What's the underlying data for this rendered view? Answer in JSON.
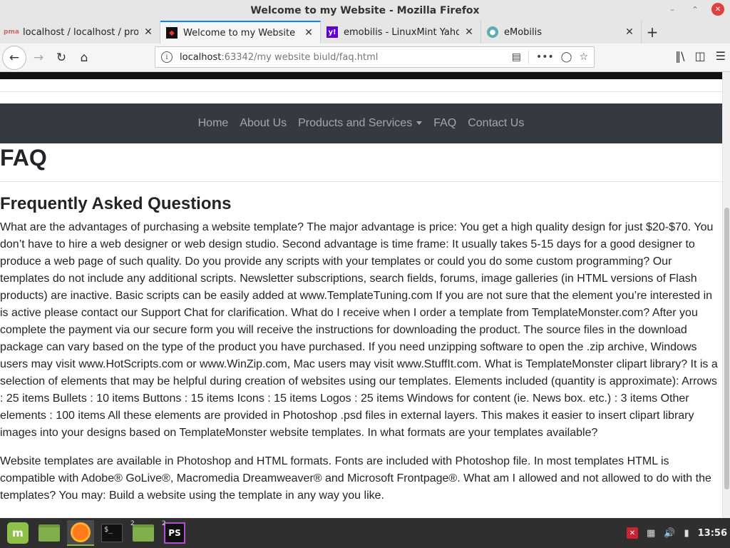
{
  "window": {
    "title": "Welcome to my Website - Mozilla Firefox"
  },
  "tabs": [
    {
      "label": "localhost / localhost / project",
      "icon": "phpmyadmin-icon",
      "active": false
    },
    {
      "label": "Welcome to my Website",
      "icon": "site-favicon-icon",
      "active": true
    },
    {
      "label": "emobilis - LinuxMint Yahoo Se",
      "icon": "yahoo-icon",
      "active": false
    },
    {
      "label": "eMobilis",
      "icon": "globe-icon",
      "active": false
    }
  ],
  "url": {
    "host": "localhost",
    "rest": ":63342/my website biuld/faq.html"
  },
  "site_nav": {
    "items": [
      "Home",
      "About Us",
      "Products and Services",
      "FAQ",
      "Contact Us"
    ]
  },
  "page": {
    "heading": "FAQ",
    "subheading": "Frequently Asked Questions",
    "paragraphs": [
      "What are the advantages of purchasing a website template? The major advantage is price: You get a high quality design for just $20-$70. You don’t have to hire a web designer or web design studio. Second advantage is time frame: It usually takes 5-15 days for a good designer to produce a web page of such quality. Do you provide any scripts with your templates or could you do some custom programming? Our templates do not include any additional scripts. Newsletter subscriptions, search fields, forums, image galleries (in HTML versions of Flash products) are inactive. Basic scripts can be easily added at www.TemplateTuning.com If you are not sure that the element you’re interested in is active please contact our Support Chat for clarification. What do I receive when I order a template from TemplateMonster.com? After you complete the payment via our secure form you will receive the instructions for downloading the product. The source files in the download package can vary based on the type of the product you have purchased. If you need unzipping software to open the .zip archive, Windows users may visit www.HotScripts.com or www.WinZip.com, Mac users may visit www.StuffIt.com. What is TemplateMonster clipart library? It is a selection of elements that may be helpful during creation of websites using our templates. Elements included (quantity is approximate): Arrows : 25 items Bullets : 10 items Buttons : 15 items Icons : 15 items Logos : 25 items Windows for content (ie. News box. etc.) : 3 items Other elements : 100 items All these elements are provided in Photoshop .psd files in external layers. This makes it easier to insert clipart library images into your designs based on TemplateMonster website templates. In what formats are your templates available?",
      "Website templates are available in Photoshop and HTML formats. Fonts are included with Photoshop file. In most templates HTML is compatible with Adobe® GoLive®, Macromedia Dreamweaver® and Microsoft Frontpage®. What am I allowed and not allowed to do with the templates? You may: Build a website using the template in any way you like."
    ]
  },
  "taskbar": {
    "badges": {
      "files": "2",
      "phpstorm": "2"
    },
    "terminal_label": "$_",
    "phpstorm_label": "PS",
    "mint_label": "m",
    "clock": "13:56"
  },
  "colors": {
    "site_nav_bg": "#343a40",
    "tab_accent": "#0a84ff",
    "taskbar_bg": "#2f2f2f"
  }
}
